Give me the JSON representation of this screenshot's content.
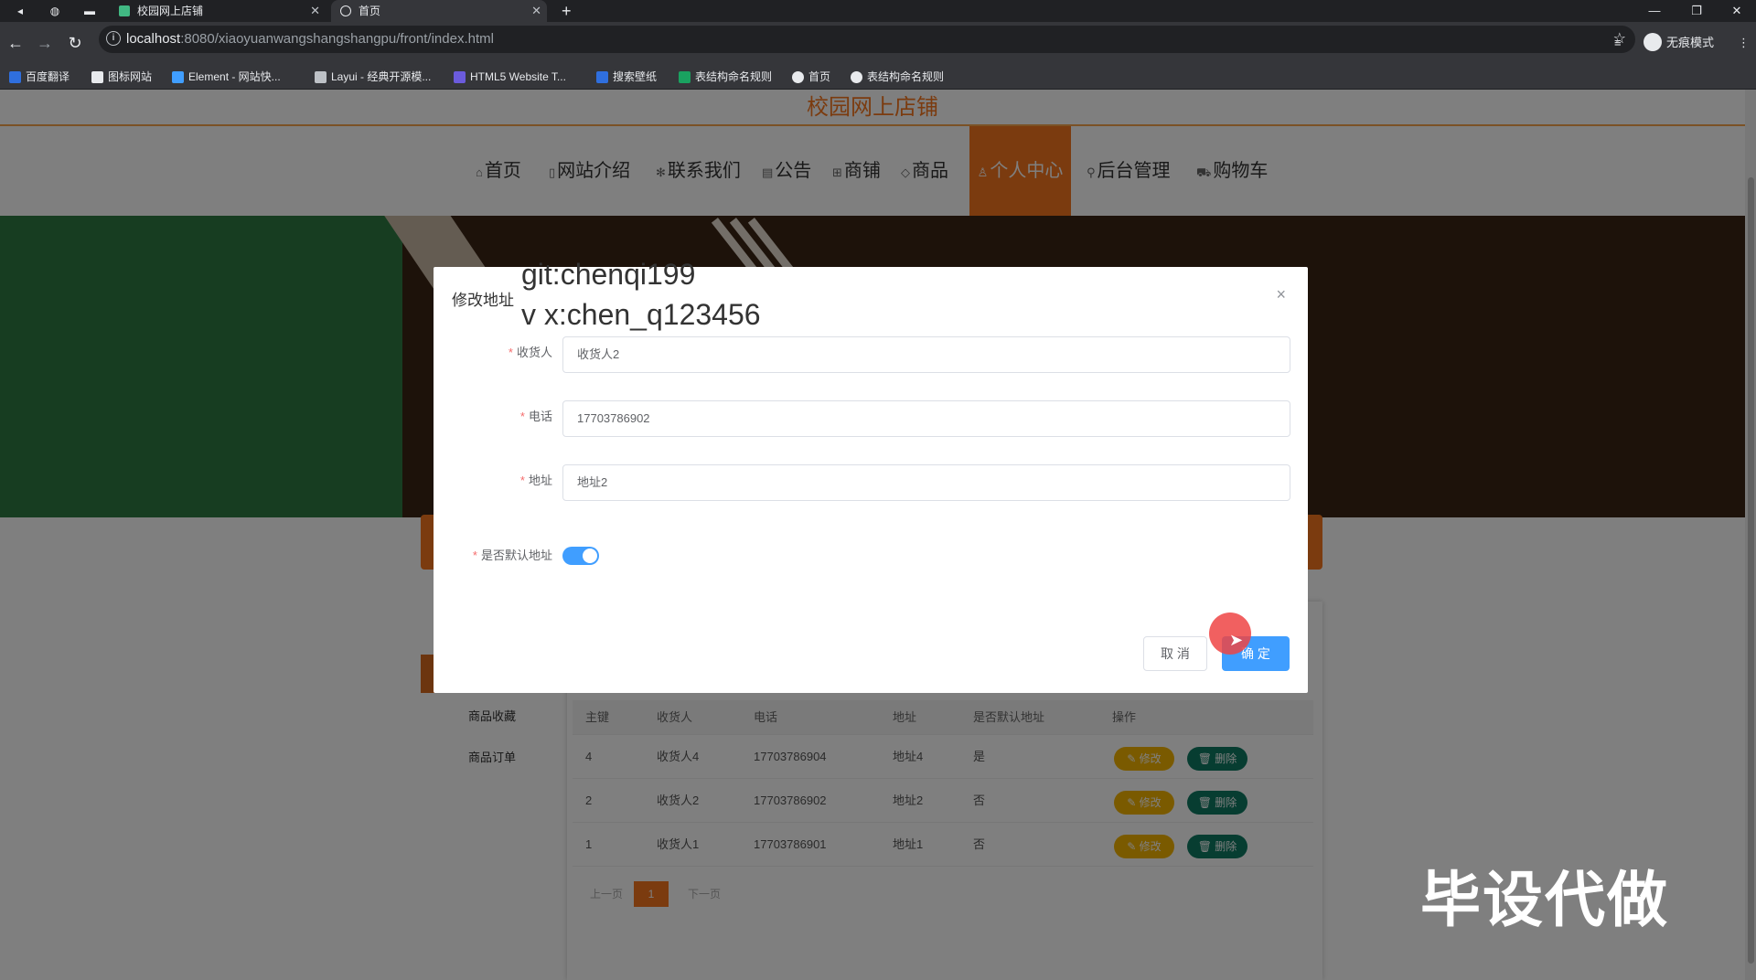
{
  "browser": {
    "tabs": [
      {
        "label": "校园网上店铺",
        "active": false
      },
      {
        "label": "首页",
        "active": true
      }
    ],
    "new_tab": "+",
    "url_host": "localhost",
    "url_rest": ":8080/xiaoyuanwangshangshangpu/front/index.html",
    "profile_label": "无痕模式",
    "bookmarks": [
      "百度翻译",
      "图标网站",
      "Element - 网站快...",
      "Layui - 经典开源模...",
      "HTML5 Website T...",
      "搜索壁纸",
      "表结构命名规则",
      "首页",
      "表结构命名规则"
    ]
  },
  "site": {
    "title": "校园网上店铺",
    "nav": [
      {
        "label": "首页",
        "icon": "home-icon",
        "glyph": "⌂"
      },
      {
        "label": "网站介绍",
        "icon": "doc-icon",
        "glyph": "▯"
      },
      {
        "label": "联系我们",
        "icon": "contact-icon",
        "glyph": "✻"
      },
      {
        "label": "公告",
        "icon": "notice-icon",
        "glyph": "▤"
      },
      {
        "label": "商铺",
        "icon": "shop-icon",
        "glyph": "⊞"
      },
      {
        "label": "商品",
        "icon": "tag-icon",
        "glyph": "◇"
      },
      {
        "label": "个人中心",
        "icon": "user-icon",
        "glyph": "♙",
        "active": true
      },
      {
        "label": "后台管理",
        "icon": "link-icon",
        "glyph": "⚲"
      },
      {
        "label": "购物车",
        "icon": "cart-icon",
        "glyph": "⛟"
      }
    ]
  },
  "sidebar": {
    "items": [
      "商品收藏",
      "商品订单"
    ]
  },
  "table": {
    "columns": [
      "主键",
      "收货人",
      "电话",
      "地址",
      "是否默认地址",
      "操作"
    ],
    "rows": [
      {
        "id": "4",
        "name": "收货人4",
        "phone": "17703786904",
        "address": "地址4",
        "default": "是"
      },
      {
        "id": "2",
        "name": "收货人2",
        "phone": "17703786902",
        "address": "地址2",
        "default": "否"
      },
      {
        "id": "1",
        "name": "收货人1",
        "phone": "17703786901",
        "address": "地址1",
        "default": "否"
      }
    ],
    "edit_label": "✎ 修改",
    "delete_label": "🗑 删除",
    "pager": {
      "prev": "上一页",
      "page": "1",
      "next": "下一页"
    }
  },
  "dialog": {
    "title": "修改地址",
    "close": "×",
    "fields": [
      {
        "label": "收货人",
        "value": "收货人2"
      },
      {
        "label": "电话",
        "value": "17703786902"
      },
      {
        "label": "地址",
        "value": "地址2"
      }
    ],
    "switch_label": "是否默认地址",
    "switch_on": true,
    "cancel_label": "取 消",
    "confirm_label": "确 定"
  },
  "watermark": {
    "line1": "git:chenqi199",
    "line2": "v x:chen_q123456",
    "big": "毕设代做"
  },
  "colors": {
    "brand": "#f7771f",
    "primary": "#409eff",
    "edit": "#f5b400",
    "delete": "#0e7a63"
  }
}
